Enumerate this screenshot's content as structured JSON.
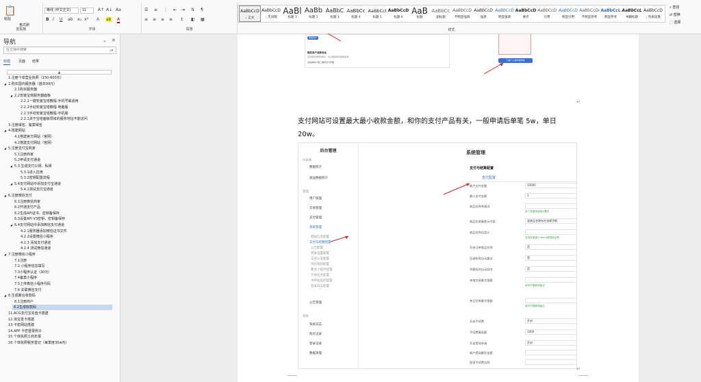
{
  "ribbon": {
    "clipboard": {
      "paste": "粘贴",
      "format_painter": "格式刷",
      "label": "剪贴板"
    },
    "font": {
      "name": "等线 (中文正文)",
      "size": "11",
      "label": "字体"
    },
    "paragraph": {
      "label": "段落"
    },
    "styles": {
      "label": "样式",
      "items": [
        {
          "sample": "AaBbCcD",
          "name": "₊ 正文",
          "size": "6px",
          "active": true
        },
        {
          "sample": "AaBbCcD",
          "name": "₊ 无间隔",
          "size": "6px"
        },
        {
          "sample": "AaBl",
          "name": "标题 1",
          "size": "12px"
        },
        {
          "sample": "AaBb",
          "name": "标题 2",
          "size": "10px"
        },
        {
          "sample": "AaBbC",
          "name": "标题 3",
          "size": "8px"
        },
        {
          "sample": "AaBbCc",
          "name": "标题 4",
          "size": "7px"
        },
        {
          "sample": "AaBbCcl",
          "name": "标题 5",
          "size": "6.5px"
        },
        {
          "sample": "AaBbCcD",
          "name": "标题 6",
          "size": "6px",
          "bold": true
        },
        {
          "sample": "AaB",
          "name": "标题",
          "size": "12px"
        },
        {
          "sample": "AaBbCc",
          "name": "副标题",
          "size": "7px",
          "color": "#666666"
        },
        {
          "sample": "AaBbCcD",
          "name": "不明显强调",
          "size": "6px",
          "italic": true,
          "color": "#555555"
        },
        {
          "sample": "AaBbCcD",
          "name": "强调",
          "size": "6px",
          "italic": true
        },
        {
          "sample": "AaBbCcD",
          "name": "明显强调",
          "size": "6px",
          "italic": true,
          "color": "#2f6fb5"
        },
        {
          "sample": "AaBbCcD",
          "name": "要点",
          "size": "6px",
          "bold": true
        },
        {
          "sample": "AaBbCcD",
          "name": "引用",
          "size": "6px",
          "italic": true,
          "color": "#555555"
        },
        {
          "sample": "AaBbCcD",
          "name": "明显引用",
          "size": "6px",
          "italic": true,
          "color": "#2f6fb5"
        },
        {
          "sample": "AaBbCcDı",
          "name": "不明显参考",
          "size": "6px",
          "color": "#555555"
        },
        {
          "sample": "AaBbCcL",
          "name": "明显参考",
          "size": "6px",
          "bold": true,
          "color": "#2f6fb5"
        },
        {
          "sample": "AaBbCcL",
          "name": "书籍标题",
          "size": "6px",
          "bold": true,
          "italic": true
        },
        {
          "sample": "AaBbCcD",
          "name": "₊ 列表段落",
          "size": "6px"
        }
      ]
    },
    "edit": {
      "find": "查找",
      "replace": "替换",
      "select": "选择"
    }
  },
  "nav": {
    "title": "导航",
    "search_placeholder": "在文档中搜索",
    "tabs": [
      "标题",
      "页面",
      "结果"
    ],
    "items": [
      {
        "text": "1.注册个体营业执照（150-600元）",
        "level": 0,
        "caret": ""
      },
      {
        "text": "2.购买国内服务器（首年99元）",
        "level": 0,
        "caret": "◢"
      },
      {
        "text": "2.1购买服务器",
        "level": 1,
        "caret": ""
      },
      {
        "text": "2.2安装宝塔服务器面板",
        "level": 1,
        "caret": "◢"
      },
      {
        "text": "2.2.1一键安装宝塔教程-手机号最适用",
        "level": 2,
        "caret": ""
      },
      {
        "text": "2.2.2手动安装宝塔教程-电脑版",
        "level": 2,
        "caret": ""
      },
      {
        "text": "2.2.3手动安装宝塔教程-手机版",
        "level": 2,
        "caret": ""
      },
      {
        "text": "2.2.1关于宝塔面板项目的服务地址不能访问",
        "level": 2,
        "caret": ""
      },
      {
        "text": "3.注册域名、备案域名",
        "level": 0,
        "caret": ""
      },
      {
        "text": "4.搭建网站",
        "level": 0,
        "caret": "◢"
      },
      {
        "text": "4.1搭建官方网站（官网）",
        "level": 1,
        "caret": ""
      },
      {
        "text": "4.2搭建支付网站（官网）",
        "level": 1,
        "caret": ""
      },
      {
        "text": "5.注册支付宝商家",
        "level": 0,
        "caret": "◢"
      },
      {
        "text": "5.1注册商家",
        "level": 1,
        "caret": ""
      },
      {
        "text": "5.2申请支付通道",
        "level": 1,
        "caret": ""
      },
      {
        "text": "5.3.生成支付公钥、私钥",
        "level": 1,
        "caret": "◢"
      },
      {
        "text": "5.3.1进入应用",
        "level": 2,
        "caret": ""
      },
      {
        "text": "5.3.2密钥配置流程",
        "level": 2,
        "caret": ""
      },
      {
        "text": "5.4支付网站中添加支付宝通道",
        "level": 1,
        "caret": "◢"
      },
      {
        "text": "5.4.1测试支付宝通道",
        "level": 2,
        "caret": ""
      },
      {
        "text": "6.注册微信支付",
        "level": 0,
        "caret": "◢"
      },
      {
        "text": "6.1注册微信商家",
        "level": 1,
        "caret": ""
      },
      {
        "text": "6.2开通支付产品",
        "level": 1,
        "caret": ""
      },
      {
        "text": "6.2生成API证书、密钥备保存",
        "level": 1,
        "caret": ""
      },
      {
        "text": "6.3设置API V3密钥，密钥备保存",
        "level": 1,
        "caret": ""
      },
      {
        "text": "6.4支付网站中添加微信支付通道",
        "level": 1,
        "caret": "◢"
      },
      {
        "text": "4.2.1服务器添加微信证书文件",
        "level": 2,
        "caret": ""
      },
      {
        "text": "4.2.2设置微信小程序",
        "level": 2,
        "caret": ""
      },
      {
        "text": "4.2.3 添加支付通道",
        "level": 2,
        "caret": ""
      },
      {
        "text": "4.2.4 测试微信通道",
        "level": 2,
        "caret": ""
      },
      {
        "text": "7.注册微信小程序",
        "level": 0,
        "caret": "◢"
      },
      {
        "text": "7.1注册",
        "level": 1,
        "caret": ""
      },
      {
        "text": "7.2 小程序信息填写",
        "level": 1,
        "caret": ""
      },
      {
        "text": "7.3小程序认证（30元）",
        "level": 1,
        "caret": ""
      },
      {
        "text": "7.4备案小程序",
        "level": 1,
        "caret": ""
      },
      {
        "text": "7.5上传微信小程序代码",
        "level": 1,
        "caret": ""
      },
      {
        "text": "7.6 关联微信支付",
        "level": 1,
        "caret": ""
      },
      {
        "text": "8.生成聚合收款码",
        "level": 0,
        "caret": "◢"
      },
      {
        "text": "8.1注册商户",
        "level": 1,
        "caret": ""
      },
      {
        "text": "8.2生成收款码",
        "level": 1,
        "caret": "",
        "selected": true
      },
      {
        "text": "11.ACG支付宝充值卡搭建",
        "level": 0,
        "caret": ""
      },
      {
        "text": "12.淘宝发卡搭建",
        "level": 0,
        "caret": ""
      },
      {
        "text": "13.卡密网站搭建",
        "level": 0,
        "caret": ""
      },
      {
        "text": "14.APP 卡密登录例子",
        "level": 0,
        "caret": ""
      },
      {
        "text": "15.个体执照工商年报",
        "level": 0,
        "caret": ""
      },
      {
        "text": "16.个体执照税务登记（每季度30w内）",
        "level": 0,
        "caret": ""
      }
    ]
  },
  "doc": {
    "paragraph": "支付网站可设置最大最小收款金额，和你的支付产品有关，一般申请后单笔 5w，单日 20w。",
    "shot1": {
      "btn": "添加商户",
      "title": "随机商户收款地址",
      "desc": "该功能支持所有商户，请以随机时切换的生效",
      "sub": "请选择商户端二维码支付界面",
      "qr_btn": "下载个人商户收款码"
    },
    "admin": {
      "title": "后台管理",
      "page_title": "系统管理",
      "card_title": "支付与结算配置",
      "tab": "支付配置",
      "sidebar": [
        {
          "text": "仪表板",
          "cls": "grey"
        },
        {
          "text": "数据统计",
          "cls": ""
        },
        {
          "text": "收益数据统计",
          "cls": ""
        },
        {
          "text": "管理",
          "cls": "grey"
        },
        {
          "text": "用户管理",
          "cls": ""
        },
        {
          "text": "交易管理",
          "cls": ""
        },
        {
          "text": "支付管理",
          "cls": ""
        },
        {
          "text": "系统管理",
          "cls": "hl"
        },
        {
          "text": "网站信息配置",
          "cls": "grey"
        },
        {
          "text": "支付与结算配置",
          "cls": "hl"
        },
        {
          "text": "公告配置",
          "cls": "grey"
        },
        {
          "text": "转账设置配置",
          "cls": "grey"
        },
        {
          "text": "实名认证配置",
          "cls": "grey"
        },
        {
          "text": "风控规则配置",
          "cls": "grey"
        },
        {
          "text": "聚合小程序配置",
          "cls": "grey"
        },
        {
          "text": "计划任务配置",
          "cls": "grey"
        },
        {
          "text": "中转站监控配置",
          "cls": "grey"
        },
        {
          "text": "登录日志配置",
          "cls": "grey"
        },
        {
          "text": "公告管理",
          "cls": ""
        },
        {
          "text": "系统",
          "cls": "grey"
        },
        {
          "text": "系统日志",
          "cls": ""
        },
        {
          "text": "购买记录",
          "cls": ""
        },
        {
          "text": "登录记录",
          "cls": ""
        },
        {
          "text": "数据清理",
          "cls": ""
        }
      ],
      "fields": [
        {
          "label": "最大支付金额",
          "value": "10000"
        },
        {
          "label": "最小支付金额",
          "value": "1"
        },
        {
          "label": "商品名称关键词",
          "value": "",
          "hint": "多个关键词使用#隔开"
        },
        {
          "label": "商品名屏蔽提示内容",
          "value": "该商品名称存在违规字眼"
        },
        {
          "label": "商品名称自定义",
          "value": "",
          "hint": "支持变量值 [name]原商品名称"
        },
        {
          "label": "开启订单商品名称",
          "value": "否"
        },
        {
          "label": "回调失败自动重试",
          "value": "是"
        },
        {
          "label": "余额低时自动扣除",
          "value": "否"
        },
        {
          "label": "单笔交易最大限额",
          "value": "",
          "hint": "填写不限额请留空"
        },
        {
          "label": "单日交易最大限额",
          "value": "",
          "hint": "填写不限额请留空"
        },
        {
          "label": "开启手续费",
          "value": "开启"
        },
        {
          "label": "手续费最低额",
          "value": "1000"
        },
        {
          "label": "开启提现申请",
          "value": "开启"
        },
        {
          "label": "商户提现最低金额",
          "value": ""
        },
        {
          "label": "提现手续费比例",
          "value": ""
        }
      ]
    }
  }
}
